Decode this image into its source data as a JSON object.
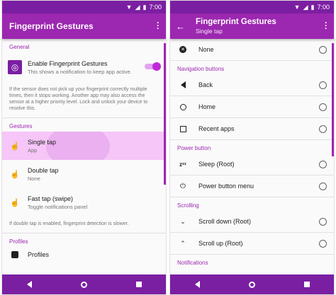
{
  "status": {
    "time": "7:00"
  },
  "left": {
    "title": "Fingerprint Gestures",
    "sections": {
      "general": "General",
      "gestures": "Gestures",
      "profiles": "Profiles"
    },
    "enable": {
      "label": "Enable Fingerprint Gestures",
      "desc": "This shows a notification to keep app active.",
      "enabled": true
    },
    "sensor_note": "If the sensor does not pick up your fingerprint correctly multiple times, then it stops working. Another app may also access the sensor at a higher priority level. Lock and unlock your device to resolve this.",
    "gestures": [
      {
        "label": "Single tap",
        "value": "App"
      },
      {
        "label": "Double tap",
        "value": "None"
      },
      {
        "label": "Fast tap (swipe)",
        "value": "Toggle notifications panel"
      }
    ],
    "double_tap_note": "If double tap is enabled, fingerprint detection is slower.",
    "profiles_item": "Profiles"
  },
  "right": {
    "title": "Fingerprint Gestures",
    "subtitle": "Single tap",
    "none_label": "None",
    "sections": {
      "navigation": "Navigation buttons",
      "power": "Power button",
      "scrolling": "Scrolling",
      "notifications": "Notifications"
    },
    "navigation": [
      "Back",
      "Home",
      "Recent apps"
    ],
    "power": [
      "Sleep (Root)",
      "Power button menu"
    ],
    "scrolling": [
      "Scroll down (Root)",
      "Scroll up (Root)"
    ]
  }
}
